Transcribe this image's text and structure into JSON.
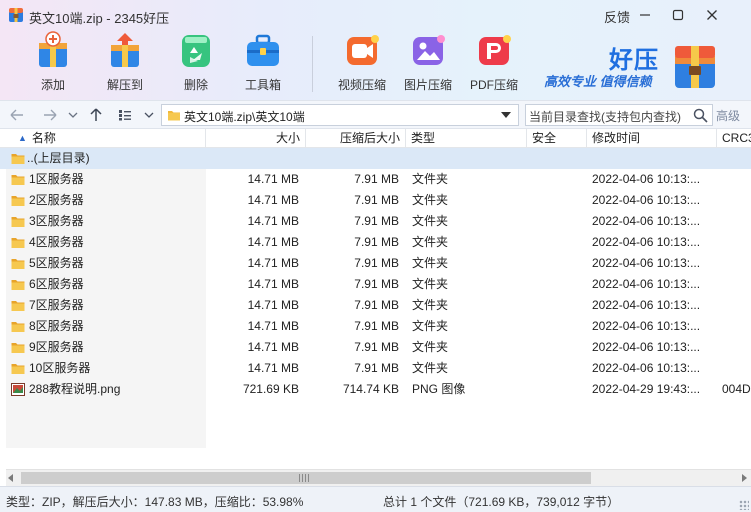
{
  "window": {
    "title": "英文10端.zip - 2345好压",
    "feedback_label": "反馈",
    "controls": [
      "minimize",
      "maximize",
      "close"
    ]
  },
  "toolbar": {
    "items": [
      {
        "id": "add",
        "label": "添加",
        "icon": "add-archive-icon"
      },
      {
        "id": "extract",
        "label": "解压到",
        "icon": "extract-archive-icon"
      },
      {
        "id": "delete",
        "label": "删除",
        "icon": "recycle-icon"
      },
      {
        "id": "tools",
        "label": "工具箱",
        "icon": "toolbox-icon"
      },
      {
        "id": "video",
        "label": "视频压缩",
        "icon": "video-compress-icon"
      },
      {
        "id": "image",
        "label": "图片压缩",
        "icon": "image-compress-icon"
      },
      {
        "id": "pdf",
        "label": "PDF压缩",
        "icon": "pdf-compress-icon"
      }
    ]
  },
  "brand": {
    "name": "好压",
    "slogan": "高效专业 值得信赖"
  },
  "address": {
    "path": "英文10端.zip\\英文10端",
    "search_placeholder": "当前目录查找(支持包内查找)",
    "advanced_label": "高级"
  },
  "columns": {
    "name": "名称",
    "size": "大小",
    "packed": "压缩后大小",
    "type": "类型",
    "security": "安全",
    "modified": "修改时间",
    "crc": "CRC3"
  },
  "files": [
    {
      "name": "..(上层目录)",
      "size": "",
      "packed": "",
      "type": "",
      "security": "",
      "modified": "",
      "crc": "",
      "kind": "parent"
    },
    {
      "name": "1区服务器",
      "size": "14.71 MB",
      "packed": "7.91 MB",
      "type": "文件夹",
      "security": "",
      "modified": "2022-04-06 10:13:...",
      "crc": "",
      "kind": "folder"
    },
    {
      "name": "2区服务器",
      "size": "14.71 MB",
      "packed": "7.91 MB",
      "type": "文件夹",
      "security": "",
      "modified": "2022-04-06 10:13:...",
      "crc": "",
      "kind": "folder"
    },
    {
      "name": "3区服务器",
      "size": "14.71 MB",
      "packed": "7.91 MB",
      "type": "文件夹",
      "security": "",
      "modified": "2022-04-06 10:13:...",
      "crc": "",
      "kind": "folder"
    },
    {
      "name": "4区服务器",
      "size": "14.71 MB",
      "packed": "7.91 MB",
      "type": "文件夹",
      "security": "",
      "modified": "2022-04-06 10:13:...",
      "crc": "",
      "kind": "folder"
    },
    {
      "name": "5区服务器",
      "size": "14.71 MB",
      "packed": "7.91 MB",
      "type": "文件夹",
      "security": "",
      "modified": "2022-04-06 10:13:...",
      "crc": "",
      "kind": "folder"
    },
    {
      "name": "6区服务器",
      "size": "14.71 MB",
      "packed": "7.91 MB",
      "type": "文件夹",
      "security": "",
      "modified": "2022-04-06 10:13:...",
      "crc": "",
      "kind": "folder"
    },
    {
      "name": "7区服务器",
      "size": "14.71 MB",
      "packed": "7.91 MB",
      "type": "文件夹",
      "security": "",
      "modified": "2022-04-06 10:13:...",
      "crc": "",
      "kind": "folder"
    },
    {
      "name": "8区服务器",
      "size": "14.71 MB",
      "packed": "7.91 MB",
      "type": "文件夹",
      "security": "",
      "modified": "2022-04-06 10:13:...",
      "crc": "",
      "kind": "folder"
    },
    {
      "name": "9区服务器",
      "size": "14.71 MB",
      "packed": "7.91 MB",
      "type": "文件夹",
      "security": "",
      "modified": "2022-04-06 10:13:...",
      "crc": "",
      "kind": "folder"
    },
    {
      "name": "10区服务器",
      "size": "14.71 MB",
      "packed": "7.91 MB",
      "type": "文件夹",
      "security": "",
      "modified": "2022-04-06 10:13:...",
      "crc": "",
      "kind": "folder"
    },
    {
      "name": "288教程说明.png",
      "size": "721.69 KB",
      "packed": "714.74 KB",
      "type": "PNG 图像",
      "security": "",
      "modified": "2022-04-29 19:43:...",
      "crc": "004D",
      "kind": "image"
    }
  ],
  "status": {
    "left": "类型：ZIP，解压后大小：147.83 MB，压缩比：53.98%",
    "right": "总计 1 个文件（721.69 KB，739,012 字节）"
  },
  "colors": {
    "accent": "#1f6fe0",
    "selected_row": "#dbe8f7",
    "folder": "#f2b93b"
  }
}
